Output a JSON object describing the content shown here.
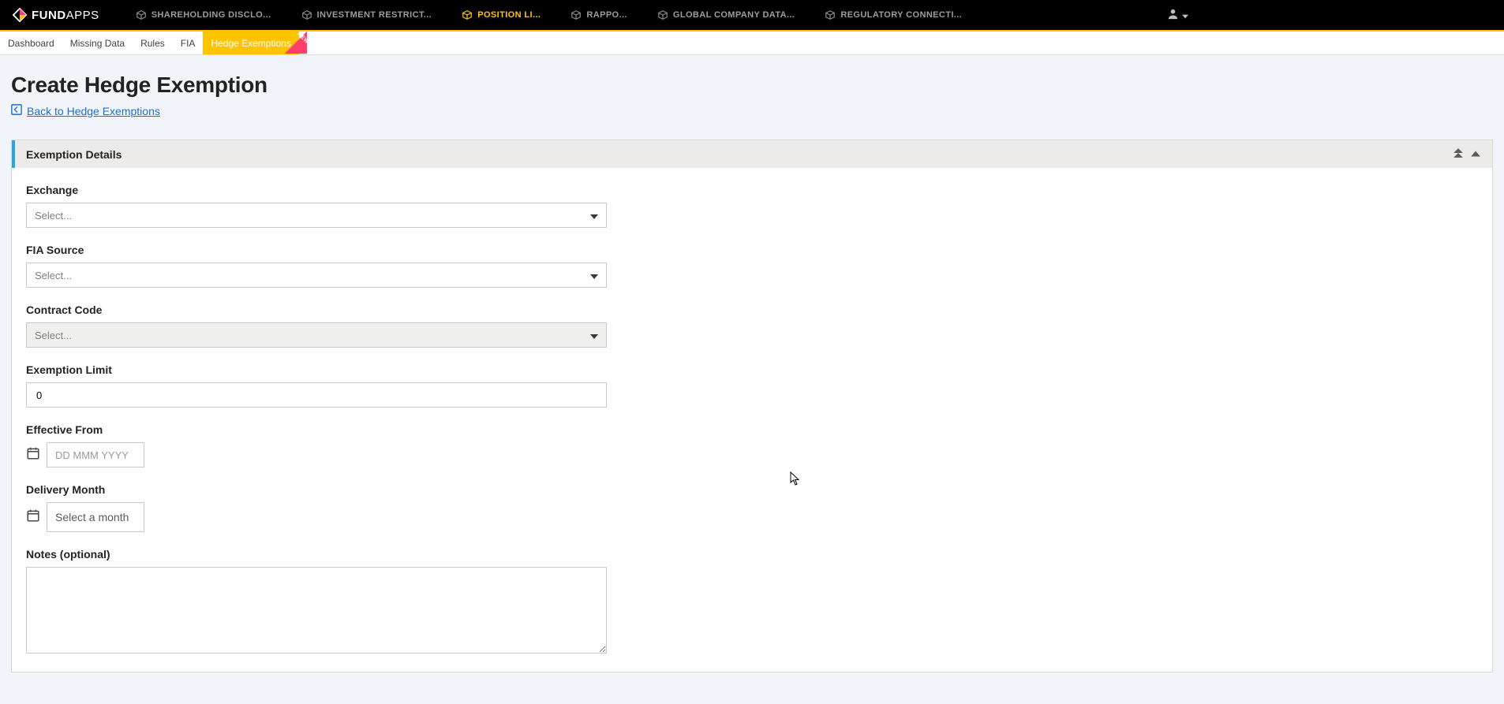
{
  "brand": {
    "bold": "FUND",
    "light": "APPS"
  },
  "top_nav": [
    {
      "label": "SHAREHOLDING DISCLO...",
      "active": false
    },
    {
      "label": "INVESTMENT RESTRICT...",
      "active": false
    },
    {
      "label": "POSITION LI...",
      "active": true
    },
    {
      "label": "RAPPO...",
      "active": false
    },
    {
      "label": "GLOBAL COMPANY DATA...",
      "active": false
    },
    {
      "label": "REGULATORY CONNECTI...",
      "active": false
    }
  ],
  "sub_tabs": [
    {
      "label": "Dashboard",
      "active": false
    },
    {
      "label": "Missing Data",
      "active": false
    },
    {
      "label": "Rules",
      "active": false
    },
    {
      "label": "FIA",
      "active": false
    },
    {
      "label": "Hedge Exemptions",
      "active": true,
      "badge": "NEW"
    }
  ],
  "page": {
    "title": "Create Hedge Exemption",
    "back_label": "Back to Hedge Exemptions"
  },
  "panel": {
    "title": "Exemption Details"
  },
  "form": {
    "exchange": {
      "label": "Exchange",
      "placeholder": "Select..."
    },
    "fia_source": {
      "label": "FIA Source",
      "placeholder": "Select..."
    },
    "contract_code": {
      "label": "Contract Code",
      "placeholder": "Select...",
      "disabled": true
    },
    "exemption_limit": {
      "label": "Exemption Limit",
      "value": "0"
    },
    "effective_from": {
      "label": "Effective From",
      "placeholder": "DD MMM YYYY"
    },
    "delivery_month": {
      "label": "Delivery Month",
      "placeholder": "Select a month"
    },
    "notes": {
      "label": "Notes (optional)",
      "value": ""
    }
  }
}
